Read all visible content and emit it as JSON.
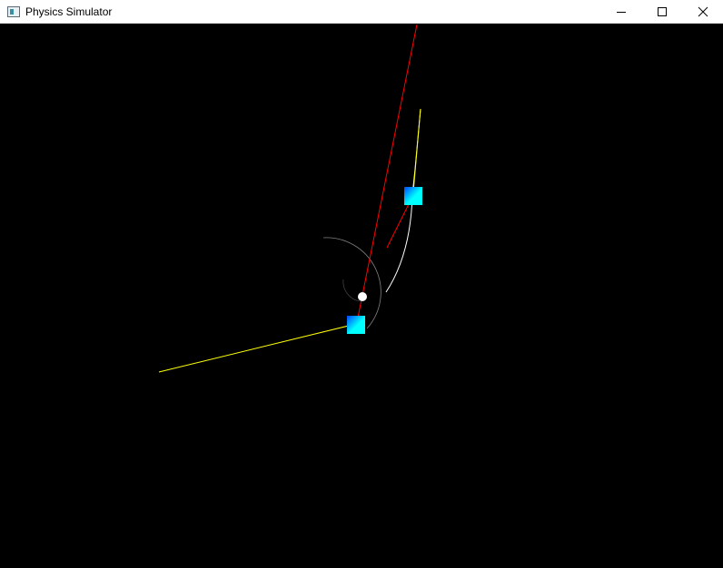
{
  "window": {
    "title": "Physics Simulator",
    "icon": "app-window-icon",
    "controls": [
      "minimize-icon",
      "maximize-icon",
      "close-icon"
    ]
  },
  "scene": {
    "background": "#000000",
    "colors": {
      "force_line": "#ff0000",
      "velocity_line": "#ffff00",
      "trail": "#ffffff",
      "orbit_arc": "#808080",
      "pivot": "#ffffff",
      "body_light": "#00ffff",
      "body_dark": "#0044ff"
    }
  }
}
